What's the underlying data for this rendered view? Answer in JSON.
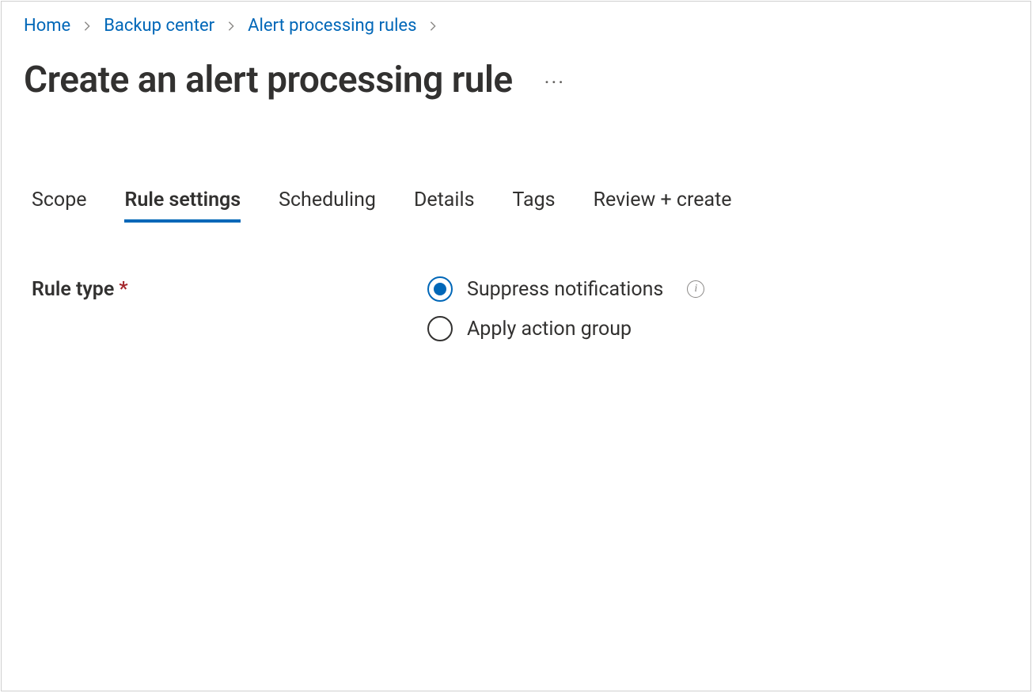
{
  "breadcrumb": {
    "items": [
      {
        "label": "Home"
      },
      {
        "label": "Backup center"
      },
      {
        "label": "Alert processing rules"
      }
    ]
  },
  "header": {
    "title": "Create an alert processing rule",
    "more_label": "···"
  },
  "tabs": [
    {
      "label": "Scope",
      "active": false
    },
    {
      "label": "Rule settings",
      "active": true
    },
    {
      "label": "Scheduling",
      "active": false
    },
    {
      "label": "Details",
      "active": false
    },
    {
      "label": "Tags",
      "active": false
    },
    {
      "label": "Review + create",
      "active": false
    }
  ],
  "form": {
    "rule_type": {
      "label": "Rule type",
      "required_mark": "*",
      "options": [
        {
          "label": "Suppress notifications",
          "selected": true,
          "has_info": true
        },
        {
          "label": "Apply action group",
          "selected": false,
          "has_info": false
        }
      ],
      "info_glyph": "i"
    }
  }
}
